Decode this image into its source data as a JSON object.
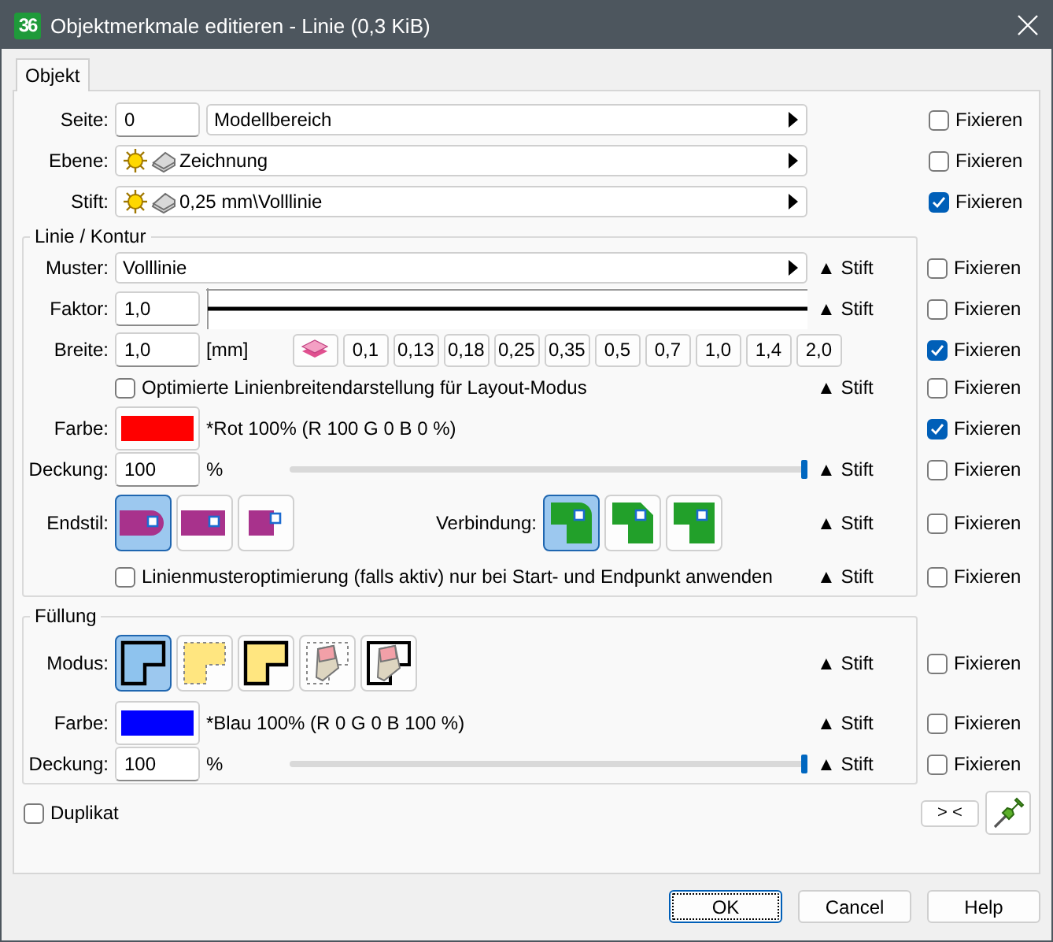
{
  "window": {
    "logo": "36",
    "title": "Objektmerkmale editieren - Linie (0,3 KiB)"
  },
  "tabs": [
    {
      "label": "Objekt",
      "selected": true
    }
  ],
  "top_rows": [
    {
      "kind": "page",
      "label": "Seite:",
      "number": "0",
      "value": "Modellbereich",
      "fix": {
        "label": "Fixieren",
        "checked": false
      }
    },
    {
      "kind": "layer",
      "label": "Ebene:",
      "value": "Zeichnung",
      "fix": {
        "label": "Fixieren",
        "checked": false
      }
    },
    {
      "kind": "layer",
      "label": "Stift:",
      "value": "0,25 mm\\Volllinie",
      "fix": {
        "label": "Fixieren",
        "checked": true
      }
    }
  ],
  "line_group": {
    "title": "Linie / Kontur",
    "rows": [
      {
        "kind": "select",
        "label": "Muster:",
        "value": "Volllinie",
        "stift": "▲ Stift",
        "fix": {
          "label": "Fixieren",
          "checked": false
        }
      },
      {
        "kind": "factor",
        "label": "Faktor:",
        "number": "1,0",
        "stift": "▲ Stift",
        "fix": {
          "label": "Fixieren",
          "checked": false
        }
      },
      {
        "kind": "width",
        "label": "Breite:",
        "number": "1,0",
        "unit": "[mm]",
        "widths": [
          "0,1",
          "0,13",
          "0,18",
          "0,25",
          "0,35",
          "0,5",
          "0,7",
          "1,0",
          "1,4",
          "2,0"
        ],
        "fix": {
          "label": "Fixieren",
          "checked": true
        }
      },
      {
        "kind": "checkbox",
        "text": "Optimierte Linienbreitendarstellung für Layout-Modus",
        "checked": false,
        "stift": "▲ Stift",
        "fix": {
          "label": "Fixieren",
          "checked": false
        }
      },
      {
        "kind": "color",
        "label": "Farbe:",
        "color": "#ff0000",
        "text": "*Rot 100% (R 100 G 0 B 0 %)",
        "fix": {
          "label": "Fixieren",
          "checked": true
        }
      },
      {
        "kind": "opacity",
        "label": "Deckung:",
        "number": "100",
        "unit": "%",
        "level": 1,
        "stift": "▲ Stift",
        "fix": {
          "label": "Fixieren",
          "checked": false
        }
      },
      {
        "kind": "styles",
        "label": "Endstil:",
        "options": [
          {
            "kind": "cap_round",
            "selected": true
          },
          {
            "kind": "cap_square",
            "selected": false
          },
          {
            "kind": "cap_flat",
            "selected": false
          }
        ],
        "label2": "Verbindung:",
        "options2": [
          {
            "kind": "join_round",
            "selected": true
          },
          {
            "kind": "join_bevel",
            "selected": false
          },
          {
            "kind": "join_miter",
            "selected": false
          }
        ],
        "stift": "▲ Stift",
        "fix": {
          "label": "Fixieren",
          "checked": false
        }
      },
      {
        "kind": "checkbox",
        "text": "Linienmusteroptimierung (falls aktiv) nur bei Start- und Endpunkt anwenden",
        "checked": false,
        "stift": "▲ Stift",
        "fix": {
          "label": "Fixieren",
          "checked": false
        }
      }
    ]
  },
  "fill_group": {
    "title": "Füllung",
    "rows": [
      {
        "kind": "styles",
        "label": "Modus:",
        "options": [
          {
            "kind": "fill_solid",
            "selected": true
          },
          {
            "kind": "fill_dashed",
            "selected": false
          },
          {
            "kind": "fill_outlined",
            "selected": false
          },
          {
            "kind": "erase_dashed",
            "selected": false
          },
          {
            "kind": "erase_outlined",
            "selected": false
          }
        ],
        "stift": "▲ Stift",
        "fix": {
          "label": "Fixieren",
          "checked": false
        }
      },
      {
        "kind": "color",
        "label": "Farbe:",
        "color": "#0000ff",
        "text": "*Blau 100% (R 0 G 0 B 100 %)",
        "stift": "▲ Stift",
        "fix": {
          "label": "Fixieren",
          "checked": false
        }
      },
      {
        "kind": "opacity",
        "label": "Deckung:",
        "number": "100",
        "unit": "%",
        "level": 1,
        "stift": "▲ Stift",
        "fix": {
          "label": "Fixieren",
          "checked": false
        }
      }
    ]
  },
  "duplicate": {
    "label": "Duplikat",
    "checked": false
  },
  "swap_button": "> <",
  "buttons": [
    {
      "label": "OK",
      "focused": true
    },
    {
      "label": "Cancel",
      "focused": false
    },
    {
      "label": "Help",
      "focused": false
    }
  ]
}
